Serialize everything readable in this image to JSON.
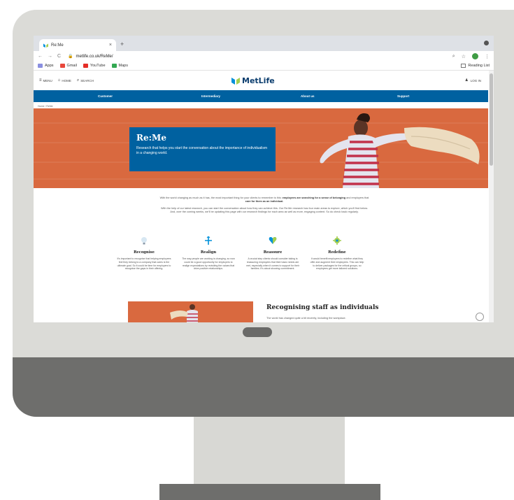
{
  "browser": {
    "tab_title": "Re:Me",
    "tab_close": "×",
    "new_tab": "+",
    "nav_back": "←",
    "nav_forward": "→",
    "nav_reload": "C",
    "url": "metlife.co.uk/ReMe/",
    "zoom_icon": "⌕",
    "star_icon": "☆",
    "menu_icon": "⋮",
    "bookmarks": [
      {
        "label": "Apps",
        "icon": "apps-grid-icon"
      },
      {
        "label": "Gmail",
        "icon": "gmail-icon"
      },
      {
        "label": "YouTube",
        "icon": "youtube-icon"
      },
      {
        "label": "Maps",
        "icon": "maps-icon"
      }
    ],
    "reading_list": "Reading List"
  },
  "site": {
    "header_links": [
      {
        "label": "MENU",
        "icon": "hamburger-icon",
        "glyph": "≡"
      },
      {
        "label": "HOME",
        "icon": "home-icon",
        "glyph": "⌂"
      },
      {
        "label": "SEARCH",
        "icon": "search-icon",
        "glyph": "⌕"
      }
    ],
    "logo": "MetLife",
    "login": "LOG IN",
    "login_glyph": "♟",
    "nav": [
      "Customer",
      "Intermediary",
      "About us",
      "Support"
    ],
    "breadcrumb": "Home / ReMe"
  },
  "hero": {
    "title": "Re:Me",
    "subtitle": "Research that helps you start the conversation about the importance of individualism in a changing world."
  },
  "intro": {
    "p1_before": "With the world changing as much as it has, the most important thing for your clients to remember is this: ",
    "p1_bold1": "employees are searching for a sense of belonging",
    "p1_middle": " and employers that ",
    "p1_bold2": "care for them as an individual.",
    "p2": "With the help of our latest research, you can start the conversation about how they can achieve this. Our Re:Me research has four main areas to explore, which you'll find below. And, over the coming weeks, we'll be updating this page with our research findings for each area as well as more, engaging content. So do check back regularly."
  },
  "features": [
    {
      "title": "Recognise",
      "icon": "lightbulb-icon",
      "text": "It's important to recognise that helping employees feel they belong to a company that cares is the ultimate goal. So it could be time for employers to recognise the gaps in their offering."
    },
    {
      "title": "Realign",
      "icon": "arrows-icon",
      "text": "The way people are working is changing, so now could be a good opportunity for employers to realign expectations by revisiting the values that drive positive relationships."
    },
    {
      "title": "Reassure",
      "icon": "heart-icon",
      "text": "A crucial step clients should consider taking is reassuring employees that their basic needs are met, especially when it comes to support for their families. It's about showing commitment."
    },
    {
      "title": "Redefine",
      "icon": "gear-icon",
      "text": "It would benefit employers to redefine what they offer and augment their employees. This can help to deliver packages for the critical groups, so employees get more tailored solutions."
    }
  ],
  "section": {
    "title": "Recognising staff as individuals",
    "text": "The world has changed quite a bit recently, including the workplace."
  },
  "colors": {
    "metlife_blue": "#0061a0",
    "hero_orange": "#d9693f",
    "monitor_frame": "#dbdbd7",
    "monitor_chin": "#6e6e6c"
  }
}
